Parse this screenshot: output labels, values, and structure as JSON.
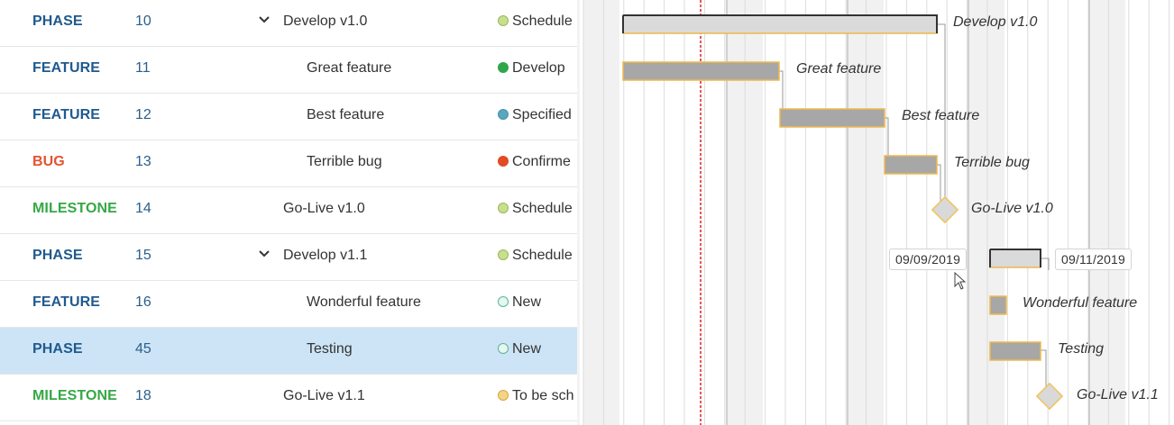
{
  "table": {
    "rows": [
      {
        "type": "PHASE",
        "type_color": "#1f5a8e",
        "id": "10",
        "subject": "Develop v1.0",
        "expander": true,
        "indent": 0,
        "status": "Schedule",
        "status_color": "#c7df8f",
        "status_border": "#99b85c",
        "selected": false
      },
      {
        "type": "FEATURE",
        "type_color": "#1f5a8e",
        "id": "11",
        "subject": "Great feature",
        "expander": false,
        "indent": 1,
        "status": "Develop",
        "status_color": "#2fa64a",
        "status_border": "#2fa64a",
        "selected": false
      },
      {
        "type": "FEATURE",
        "type_color": "#1f5a8e",
        "id": "12",
        "subject": "Best feature",
        "expander": false,
        "indent": 1,
        "status": "Specified",
        "status_color": "#57a7bf",
        "status_border": "#4a93a9",
        "selected": false
      },
      {
        "type": "BUG",
        "type_color": "#e5532f",
        "id": "13",
        "subject": "Terrible bug",
        "expander": false,
        "indent": 1,
        "status": "Confirme",
        "status_color": "#e14a24",
        "status_border": "#e14a24",
        "selected": false
      },
      {
        "type": "MILESTONE",
        "type_color": "#35a845",
        "id": "14",
        "subject": "Go-Live v1.0",
        "expander": false,
        "indent": 0,
        "status": "Schedule",
        "status_color": "#c7df8f",
        "status_border": "#99b85c",
        "selected": false
      },
      {
        "type": "PHASE",
        "type_color": "#1f5a8e",
        "id": "15",
        "subject": "Develop v1.1",
        "expander": true,
        "indent": 0,
        "status": "Schedule",
        "status_color": "#c7df8f",
        "status_border": "#99b85c",
        "selected": false
      },
      {
        "type": "FEATURE",
        "type_color": "#1f5a8e",
        "id": "16",
        "subject": "Wonderful feature",
        "expander": false,
        "indent": 1,
        "status": "New",
        "status_color": "#e6f7f1",
        "status_border": "#5ab596",
        "selected": false
      },
      {
        "type": "PHASE",
        "type_color": "#1f5a8e",
        "id": "45",
        "subject": "Testing",
        "expander": false,
        "indent": 1,
        "status": "New",
        "status_color": "#e6f7f1",
        "status_border": "#5ab596",
        "selected": true
      },
      {
        "type": "MILESTONE",
        "type_color": "#35a845",
        "id": "18",
        "subject": "Go-Live v1.1",
        "expander": false,
        "indent": 0,
        "status": "To be sch",
        "status_color": "#f2d48a",
        "status_border": "#d6a73a",
        "selected": false
      }
    ]
  },
  "gantt": {
    "labels": [
      "Develop v1.0",
      "Great feature",
      "Best feature",
      "Terrible bug",
      "Go-Live v1.0",
      "",
      "Wonderful feature",
      "Testing",
      "Go-Live v1.1"
    ],
    "date_start": "09/09/2019",
    "date_end": "09/11/2019",
    "colors": {
      "bar_fill": "#a7a7a7",
      "bar_border": "#f0b94a",
      "phase_fill": "#dadada",
      "phase_border": "#333333",
      "milestone_fill": "#d9d9d9",
      "milestone_border": "#f0c35a",
      "today_line": "#e02020",
      "weekend_shade": "#f1f1f1",
      "grid": "#dcdcdc",
      "month_line": "#c4c4c4"
    }
  }
}
